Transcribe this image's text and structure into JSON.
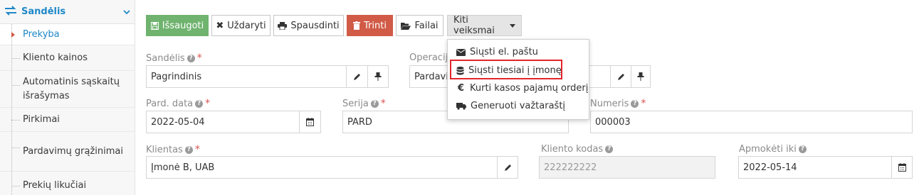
{
  "sidebar": {
    "title": "Sandėlis",
    "items": [
      {
        "label": "Prekyba",
        "active": true
      },
      {
        "label": "Kliento kainos"
      },
      {
        "label": "Automatinis sąskaitų išrašymas"
      },
      {
        "label": "Pirkimai"
      },
      {
        "label": "Pardavimų grąžinimai"
      },
      {
        "label": "Prekių likučiai"
      }
    ]
  },
  "toolbar": {
    "save": "Išsaugoti",
    "close": "Uždaryti",
    "print": "Spausdinti",
    "delete": "Trinti",
    "files": "Failai",
    "more": "Kiti veiksmai"
  },
  "menu": {
    "items": [
      {
        "label": "Siųsti el. paštu",
        "icon": "envelope-icon"
      },
      {
        "label": "Siųsti tiesiai į įmonę",
        "icon": "database-icon"
      },
      {
        "label": "Kurti kasos pajamų orderį",
        "icon": "euro-icon"
      },
      {
        "label": "Generuoti važtaraštį",
        "icon": "truck-icon"
      }
    ]
  },
  "form": {
    "warehouse_label": "Sandėlis",
    "warehouse_value": "Pagrindinis",
    "operation_label": "Operacija",
    "operation_value": "Pardavi",
    "sale_date_label": "Pard. data",
    "sale_date_value": "2022-05-04",
    "series_label": "Serija",
    "series_value": "PARD",
    "number_label": "Numeris",
    "number_value": "000003",
    "client_label": "Klientas",
    "client_value": "Įmonė B, UAB",
    "client_code_label": "Kliento kodas",
    "client_code_value": "222222222",
    "pay_until_label": "Apmokėti iki",
    "pay_until_value": "2022-05-14"
  },
  "colors": {
    "accent": "#1e88c8",
    "success": "#6fb36f",
    "danger": "#d15b47",
    "highlight_border": "#e2252b"
  }
}
